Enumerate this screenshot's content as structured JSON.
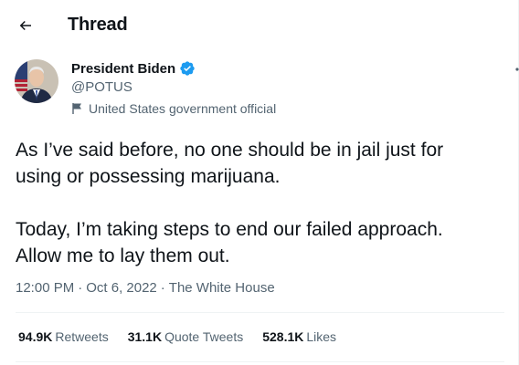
{
  "header": {
    "title": "Thread",
    "back_icon": "arrow-left-icon"
  },
  "tweet": {
    "author": {
      "name": "President Biden",
      "handle": "@POTUS",
      "verified": true,
      "verified_color": "#1d9bf0",
      "label": "United States government official",
      "label_icon": "flag-icon"
    },
    "text": "As I’ve said before, no one should be in jail just for\nusing or possessing marijuana.\n\nToday, I’m taking steps to end our failed approach.\nAllow me to lay them out.",
    "time": "12:00 PM",
    "date": "Oct 6, 2022",
    "source": "The White House",
    "separator": "·",
    "stats": {
      "retweets": {
        "count": "94.9K",
        "label": "Retweets"
      },
      "quote_tweets": {
        "count": "31.1K",
        "label": "Quote Tweets"
      },
      "likes": {
        "count": "528.1K",
        "label": "Likes"
      }
    }
  }
}
